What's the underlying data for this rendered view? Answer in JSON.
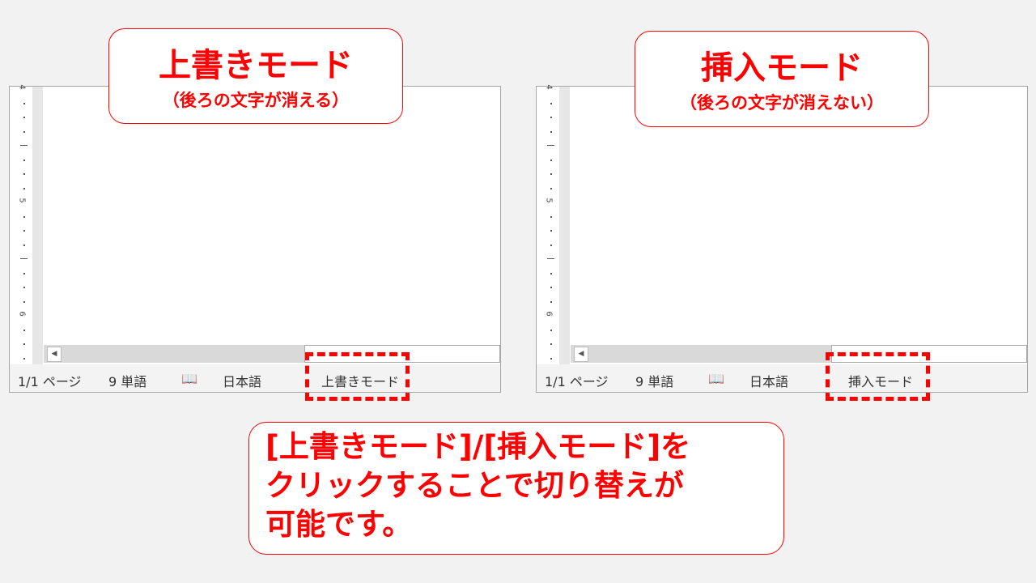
{
  "left_panel": {
    "status": {
      "page": "1/1 ページ",
      "words": "9 単語",
      "language": "日本語",
      "mode": "上書きモード"
    },
    "callout": {
      "title": "上書きモード",
      "subtitle": "（後ろの文字が消える）"
    }
  },
  "right_panel": {
    "status": {
      "page": "1/1 ページ",
      "words": "9 単語",
      "language": "日本語",
      "mode": "挿入モード"
    },
    "callout": {
      "title": "挿入モード",
      "subtitle": "（後ろの文字が消えない）"
    }
  },
  "ruler_labels": [
    "4",
    "5",
    "6"
  ],
  "note": {
    "lines": [
      "[上書きモード]/[挿入モード]を",
      "クリックすることで切り替えが",
      "可能です。"
    ]
  },
  "colors": {
    "accent": "#ff0000"
  }
}
